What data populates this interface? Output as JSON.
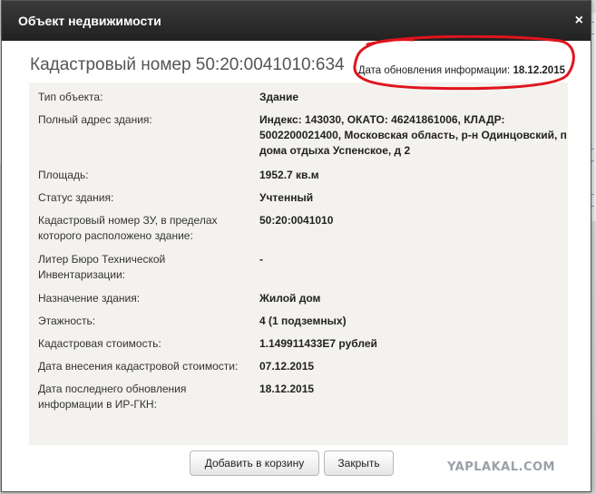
{
  "dialog": {
    "title": "Объект недвижимости",
    "close_symbol": "×",
    "close_icon": "close-icon"
  },
  "header": {
    "cadastral_title": "Кадастровый номер 50:20:0041010:634",
    "update_label": "Дата обновления информации: ",
    "update_date": "18.12.2015"
  },
  "details": [
    {
      "label": "Тип объекта:",
      "value": "Здание"
    },
    {
      "label": "Полный адрес здания:",
      "value": "Индекс: 143030, ОКАТО: 46241861006, КЛАДР: 5002200021400, Московская область, р-н Одинцовский, п дома отдыха Успенское, д 2"
    },
    {
      "label": "Площадь:",
      "value": "1952.7 кв.м"
    },
    {
      "label": "Статус здания:",
      "value": "Учтенный"
    },
    {
      "label": "Кадастровый номер ЗУ, в пределах которого расположено здание:",
      "value": "50:20:0041010"
    },
    {
      "label": "Литер Бюро Технической Инвентаризации:",
      "value": "-"
    },
    {
      "label": "Назначение здания:",
      "value": "Жилой дом"
    },
    {
      "label": "Этажность:",
      "value": "4 (1 подземных)"
    },
    {
      "label": "Кадастровая стоимость:",
      "value": "1.149911433E7 рублей"
    },
    {
      "label": "Дата внесения кадастровой стоимости:",
      "value": "07.12.2015"
    },
    {
      "label": "Дата последнего обновления информации в ИР-ГКН:",
      "value": "18.12.2015"
    }
  ],
  "buttons": {
    "add_to_cart": "Добавить в корзину",
    "close": "Закрыть"
  },
  "watermark": "YAPLAKAL.COM",
  "colors": {
    "titlebar": "#2b2b2b",
    "panel": "#f4f2ee",
    "annotation": "#e0141e"
  }
}
